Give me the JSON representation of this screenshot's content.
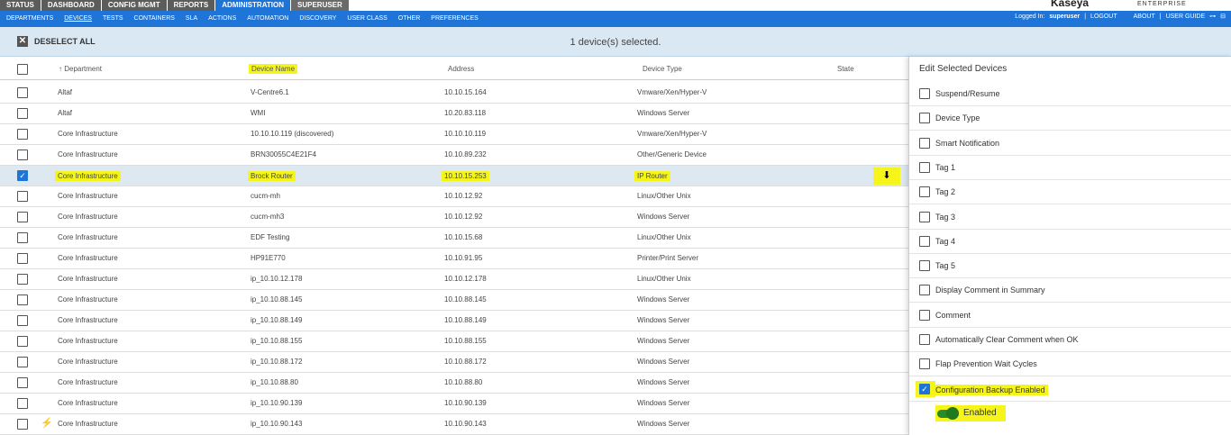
{
  "top_tabs": [
    "STATUS",
    "DASHBOARD",
    "CONFIG MGMT",
    "REPORTS",
    "ADMINISTRATION",
    "SUPERUSER"
  ],
  "brand": {
    "name": "Kaseya",
    "edition": "ENTERPRISE"
  },
  "nav_links": [
    "DEPARTMENTS",
    "DEVICES",
    "TESTS",
    "CONTAINERS",
    "SLA",
    "ACTIONS",
    "AUTOMATION",
    "DISCOVERY",
    "USER CLASS",
    "OTHER",
    "PREFERENCES"
  ],
  "user_bar": {
    "logged_in_label": "Logged In:",
    "user": "superuser",
    "sep": "|",
    "logout": "LOGOUT",
    "about": "ABOUT",
    "guide": "USER GUIDE"
  },
  "action_bar": {
    "deselect": "DESELECT ALL",
    "selection": "1 device(s) selected."
  },
  "columns": {
    "department": "Department",
    "name": "Device Name",
    "address": "Address",
    "type": "Device Type",
    "state": "State"
  },
  "rows": [
    {
      "dept": "Altaf",
      "name": "V-Centre6.1",
      "addr": "10.10.15.164",
      "type": "Vmware/Xen/Hyper-V"
    },
    {
      "dept": "Altaf",
      "name": "WMI",
      "addr": "10.20.83.118",
      "type": "Windows Server"
    },
    {
      "dept": "Core Infrastructure",
      "name": "10.10.10.119 (discovered)",
      "addr": "10.10.10.119",
      "type": "Vmware/Xen/Hyper-V"
    },
    {
      "dept": "Core Infrastructure",
      "name": "BRN30055C4E21F4",
      "addr": "10.10.89.232",
      "type": "Other/Generic Device"
    },
    {
      "dept": "Core Infrastructure",
      "name": "Brock Router",
      "addr": "10.10.15.253",
      "type": "IP Router"
    },
    {
      "dept": "Core Infrastructure",
      "name": "cucm-mh",
      "addr": "10.10.12.92",
      "type": "Linux/Other Unix"
    },
    {
      "dept": "Core Infrastructure",
      "name": "cucm-mh3",
      "addr": "10.10.12.92",
      "type": "Windows Server"
    },
    {
      "dept": "Core Infrastructure",
      "name": "EDF Testing",
      "addr": "10.10.15.68",
      "type": "Linux/Other Unix"
    },
    {
      "dept": "Core Infrastructure",
      "name": "HP91E770",
      "addr": "10.10.91.95",
      "type": "Printer/Print Server"
    },
    {
      "dept": "Core Infrastructure",
      "name": "ip_10.10.12.178",
      "addr": "10.10.12.178",
      "type": "Linux/Other Unix"
    },
    {
      "dept": "Core Infrastructure",
      "name": "ip_10.10.88.145",
      "addr": "10.10.88.145",
      "type": "Windows Server"
    },
    {
      "dept": "Core Infrastructure",
      "name": "ip_10.10.88.149",
      "addr": "10.10.88.149",
      "type": "Windows Server"
    },
    {
      "dept": "Core Infrastructure",
      "name": "ip_10.10.88.155",
      "addr": "10.10.88.155",
      "type": "Windows Server"
    },
    {
      "dept": "Core Infrastructure",
      "name": "ip_10.10.88.172",
      "addr": "10.10.88.172",
      "type": "Windows Server"
    },
    {
      "dept": "Core Infrastructure",
      "name": "ip_10.10.88.80",
      "addr": "10.10.88.80",
      "type": "Windows Server"
    },
    {
      "dept": "Core Infrastructure",
      "name": "ip_10.10.90.139",
      "addr": "10.10.90.139",
      "type": "Windows Server"
    },
    {
      "dept": "Core Infrastructure",
      "name": "ip_10.10.90.143",
      "addr": "10.10.90.143",
      "type": "Windows Server"
    }
  ],
  "panel": {
    "title": "Edit Selected Devices",
    "options": [
      "Suspend/Resume",
      "Device Type",
      "Smart Notification",
      "Tag 1",
      "Tag 2",
      "Tag 3",
      "Tag 4",
      "Tag 5",
      "Display Comment in Summary",
      "Comment",
      "Automatically Clear Comment when OK",
      "Flap Prevention Wait Cycles",
      "Configuration Backup Enabled"
    ],
    "toggle_label": "Enabled"
  }
}
